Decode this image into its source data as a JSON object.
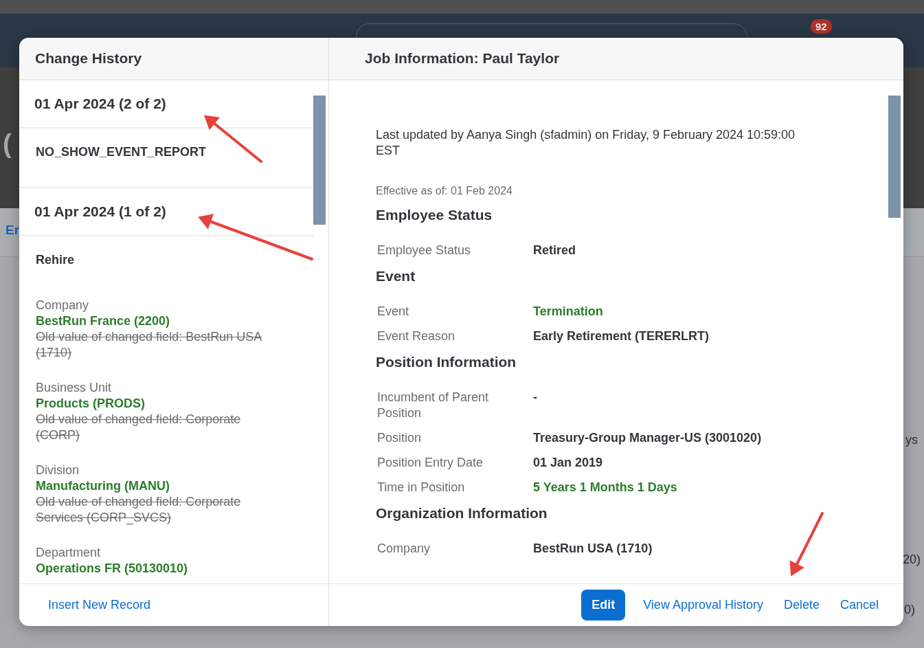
{
  "background": {
    "notification_count": "92",
    "fragments": [
      "(",
      "Er",
      "ys",
      "20)",
      "0)"
    ]
  },
  "history": {
    "title": "Change History",
    "entries": [
      {
        "date": "01 Apr 2024 (2 of 2)",
        "event": "NO_SHOW_EVENT_REPORT"
      },
      {
        "date": "01 Apr 2024 (1 of 2)",
        "event": "Rehire",
        "changes": [
          {
            "label": "Company",
            "new": "BestRun France (2200)",
            "old": "Old value of changed field: BestRun USA (1710)"
          },
          {
            "label": "Business Unit",
            "new": "Products (PRODS)",
            "old": "Old value of changed field: Corporate (CORP)"
          },
          {
            "label": "Division",
            "new": "Manufacturing (MANU)",
            "old": "Old value of changed field: Corporate Services (CORP_SVCS)"
          },
          {
            "label": "Department",
            "new": "Operations FR (50130010)"
          }
        ]
      }
    ],
    "action": "Insert New Record"
  },
  "details": {
    "title": "Job Information: Paul Taylor",
    "last_updated": "Last updated by Aanya Singh (sfadmin) on Friday, 9 February 2024 10:59:00 EST",
    "effective": "Effective as of: 01 Feb 2024",
    "sections": [
      {
        "title": "Employee Status",
        "fields": [
          {
            "label": "Employee Status",
            "value": "Retired",
            "kind": "text"
          }
        ]
      },
      {
        "title": "Event",
        "fields": [
          {
            "label": "Event",
            "value": "Termination",
            "kind": "link"
          },
          {
            "label": "Event Reason",
            "value": "Early Retirement (TERERLRT)",
            "kind": "text"
          }
        ]
      },
      {
        "title": "Position Information",
        "fields": [
          {
            "label": "Incumbent of Parent Position",
            "value": "-",
            "kind": "text"
          },
          {
            "label": "Position",
            "value": "Treasury-Group Manager-US (3001020)",
            "kind": "text"
          },
          {
            "label": "Position Entry Date",
            "value": "01 Jan 2019",
            "kind": "text"
          },
          {
            "label": "Time in Position",
            "value": "5 Years 1 Months 1 Days",
            "kind": "link"
          }
        ]
      },
      {
        "title": "Organization Information",
        "fields": [
          {
            "label": "Company",
            "value": "BestRun USA (1710)",
            "kind": "text"
          }
        ]
      }
    ],
    "buttons": [
      {
        "label": "Edit",
        "kind": "primary"
      },
      {
        "label": "View Approval History",
        "kind": "link"
      },
      {
        "label": "Delete",
        "kind": "link"
      },
      {
        "label": "Cancel",
        "kind": "link"
      }
    ]
  }
}
